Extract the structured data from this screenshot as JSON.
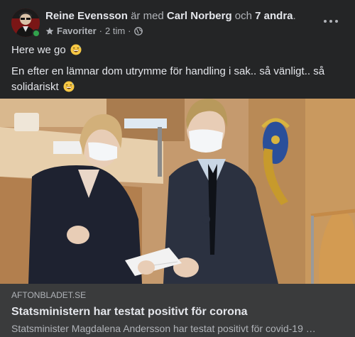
{
  "post": {
    "author": "Reine Evensson",
    "with_text": "är med",
    "tagged_person": "Carl Norberg",
    "and_text": "och",
    "others": "7 andra",
    "period": ".",
    "favorites_label": "Favoriter",
    "separator": "·",
    "timestamp": "2 tim",
    "audience_icon": "globe-icon",
    "status_color": "#31a24c",
    "text_line1": "Here we go",
    "text_line2": "En efter en lämnar dom utrymme för handling i sak.. så vänligt.. så solidariskt"
  },
  "link": {
    "domain": "AFTONBLADET.SE",
    "title": "Statsministern har testat positivt för corona",
    "description": "Statsminister Magdalena Andersson har testat positivt för covid-19 …"
  },
  "colors": {
    "background": "#242526",
    "link_card": "#3a3b3c",
    "primary_text": "#e4e6eb",
    "secondary_text": "#b0b3b8"
  }
}
